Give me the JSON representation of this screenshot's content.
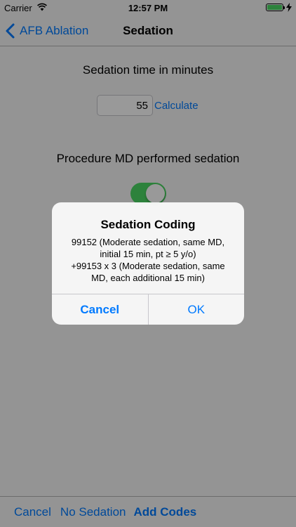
{
  "status_bar": {
    "carrier": "Carrier",
    "time": "12:57 PM",
    "wifi_icon": "wifi-icon",
    "battery_icon": "battery-icon",
    "charging_icon": "lightning-icon"
  },
  "nav": {
    "back_label": "AFB Ablation",
    "title": "Sedation"
  },
  "form": {
    "time_label": "Sedation time in minutes",
    "minutes_value": "55",
    "calculate_label": "Calculate",
    "procedure_label": "Procedure MD performed sedation",
    "procedure_toggle_on": true
  },
  "toolbar": {
    "cancel_label": "Cancel",
    "no_sedation_label": "No Sedation",
    "add_codes_label": "Add Codes"
  },
  "alert": {
    "title": "Sedation Coding",
    "message_line1": "99152 (Moderate sedation, same MD, initial 15 min, pt ≥ 5 y/o)",
    "message_line2": "+99153 x 3 (Moderate sedation, same MD, each additional 15 min)",
    "cancel_label": "Cancel",
    "ok_label": "OK"
  },
  "colors": {
    "tint": "#007aff",
    "toggle_on": "#4cd964",
    "background": "#f7f7f7"
  }
}
